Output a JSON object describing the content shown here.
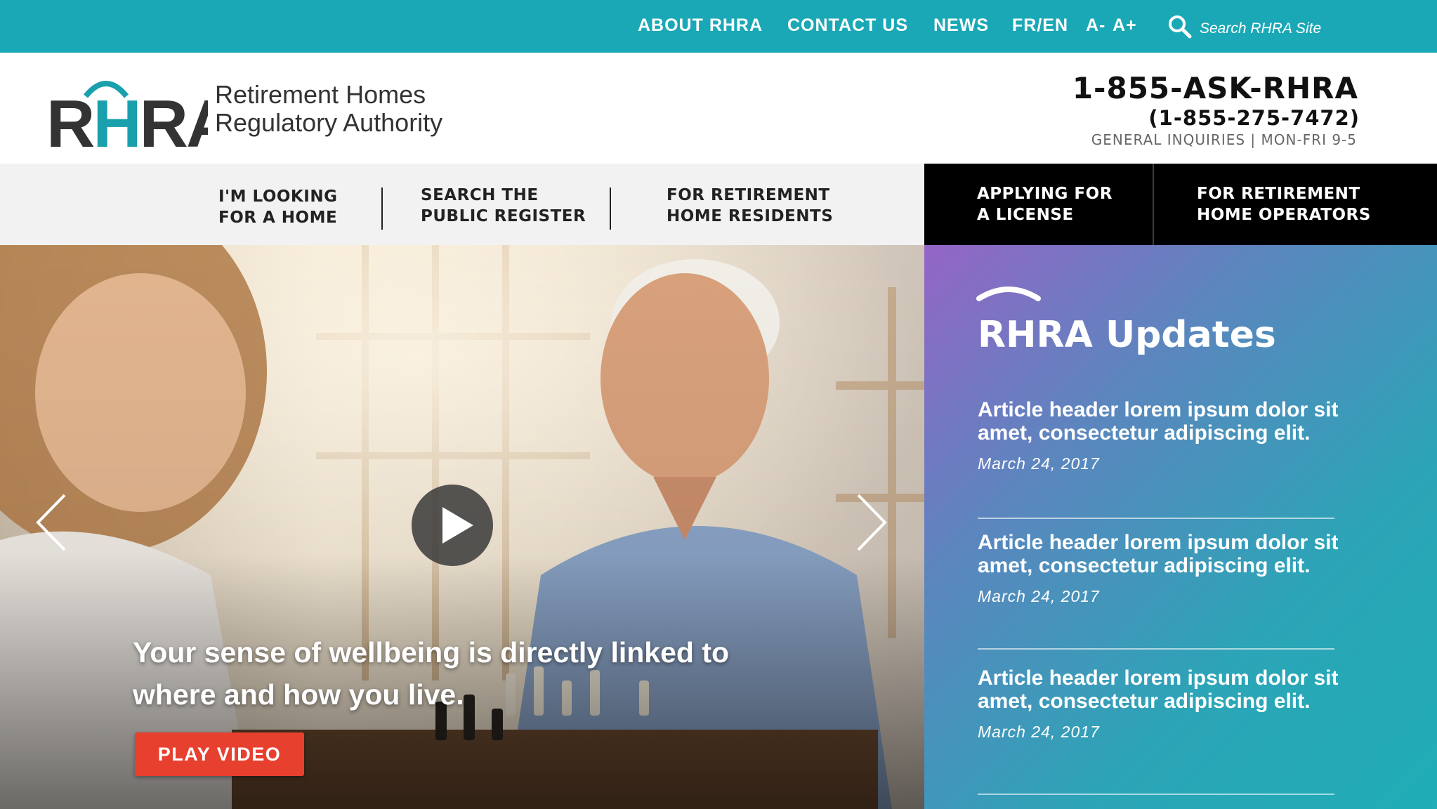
{
  "utility_nav": {
    "links": [
      "ABOUT RHRA",
      "CONTACT US",
      "NEWS",
      "FR/EN",
      "A-",
      "A+"
    ],
    "search_placeholder": "Search RHRA Site"
  },
  "header": {
    "logo_letters": "RHRA",
    "org_name_line1": "Retirement Homes",
    "org_name_line2": "Regulatory Authority",
    "phone_main": "1-855-ASK-RHRA",
    "phone_numeric": "(1-855-275-7472)",
    "hours_text": "GENERAL INQUIRIES |  MON-FRI 9-5"
  },
  "main_nav": {
    "items": [
      {
        "line1": "I'M LOOKING",
        "line2": "FOR A HOME"
      },
      {
        "line1": "SEARCH THE",
        "line2": "PUBLIC REGISTER"
      },
      {
        "line1": "FOR RETIREMENT",
        "line2": "HOME RESIDENTS"
      },
      {
        "line1": "APPLYING FOR",
        "line2": "A LICENSE"
      },
      {
        "line1": "FOR RETIREMENT",
        "line2": "HOME OPERATORS"
      }
    ]
  },
  "hero": {
    "caption": "Your sense of wellbeing is directly linked to where and how you live.",
    "button_label": "PLAY VIDEO"
  },
  "updates": {
    "title": "RHRA Updates",
    "articles": [
      {
        "title": "Article header lorem ipsum dolor sit amet, consectetur adipiscing elit.",
        "date": "March 24, 2017"
      },
      {
        "title": "Article header lorem ipsum dolor sit amet, consectetur adipiscing elit.",
        "date": "March 24, 2017"
      },
      {
        "title": "Article header lorem ipsum dolor sit amet, consectetur adipiscing elit.",
        "date": "March 24, 2017"
      }
    ]
  },
  "colors": {
    "teal": "#1ba8b6",
    "logo_teal": "#1aa0ad",
    "cta_red": "#e8402f",
    "nav_dark": "#000000",
    "nav_light": "#f2f2f2",
    "gradient_purple": "#9465c6"
  },
  "icons": {
    "search": "search-icon",
    "prev": "chevron-left-icon",
    "next": "chevron-right-icon",
    "play": "play-icon"
  }
}
